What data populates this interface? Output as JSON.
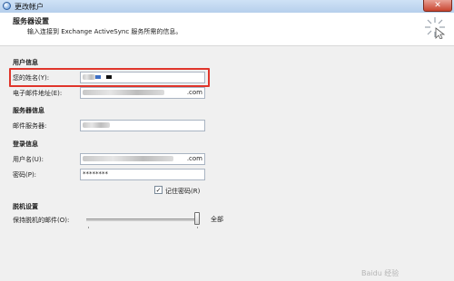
{
  "window": {
    "title": "更改帐户",
    "close_glyph": "✕"
  },
  "header": {
    "title": "服务器设置",
    "subtitle": "输入连接到 Exchange ActiveSync 服务所需的信息。"
  },
  "user_info": {
    "heading": "用户信息",
    "name_label": "您的姓名(Y):",
    "email_label": "电子邮件地址(E):",
    "email_suffix": ".com"
  },
  "server_info": {
    "heading": "服务器信息",
    "mail_server_label": "邮件服务器:"
  },
  "login_info": {
    "heading": "登录信息",
    "username_label": "用户名(U):",
    "username_suffix": ".com",
    "password_label": "密码(P):",
    "password_value": "********",
    "remember_label": "记住密码(R)",
    "remember_checked": true,
    "check_glyph": "✓"
  },
  "offline": {
    "heading": "脱机设置",
    "keep_label": "保持脱机的邮件(O):",
    "slider_value": "全部",
    "slider_level": 1.0
  },
  "watermark": "Baidu 经验",
  "colors": {
    "highlight": "#e0352b",
    "title_bar": "#b6cfec"
  }
}
